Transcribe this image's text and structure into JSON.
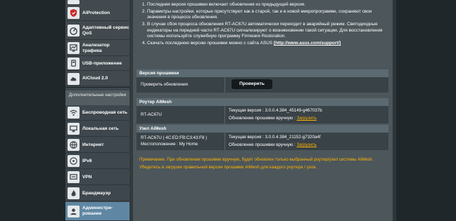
{
  "sidebar": {
    "items_top": [
      {
        "label": "",
        "icon": "folder-icon"
      },
      {
        "label": "AiProtection",
        "icon": "shield-icon"
      },
      {
        "label": "Адаптивный сервис QoS",
        "icon": "qos-icon"
      },
      {
        "label": "Анализатор трафика",
        "icon": "traffic-analyzer-icon"
      },
      {
        "label": "USB-приложение",
        "icon": "usb-icon"
      },
      {
        "label": "AiCloud 2.0",
        "icon": "cloud-icon"
      }
    ],
    "advanced_header": "Дополнительные настройки",
    "items_advanced": [
      {
        "label": "Беспроводная сеть",
        "icon": "wireless-icon"
      },
      {
        "label": "Локальная сеть",
        "icon": "lan-icon"
      },
      {
        "label": "Интернет",
        "icon": "globe-icon"
      },
      {
        "label": "IPv6",
        "icon": "ipv6-icon"
      },
      {
        "label": "VPN",
        "icon": "vpn-icon"
      },
      {
        "label": "Брандмауэр",
        "icon": "firewall-icon"
      },
      {
        "label": "Администри-рование",
        "icon": "admin-icon"
      }
    ]
  },
  "notes": {
    "items": [
      "Последняя версия прошивки включает обновления из предыдущей версии.",
      "Параметры настройки, которые присутствуют как в старой, так и в новой микропрограмме, сохраняют свои значения в процессе обновления.",
      "В случае сбоя процесса обновления RT-AC67U автоматически переходит в аварийный режим. Светодиодные индикаторы на передней части RT-AC67U сигнализируют о возникновении такой ситуации. Для восстановления системы используйте служебную программу Firmware Restoration."
    ],
    "last_prefix": "Скачать последнюю версию прошивки можно с сайта ASUS ",
    "last_link": "[http://www.asus.com/support/]"
  },
  "firmware": {
    "title": "Версия прошивки",
    "check_label": "Проверить обновления",
    "check_button": "Проверить"
  },
  "router": {
    "title": "Роутер AiMesh",
    "model": "RT-AC67U",
    "current_version": "Текущая версия : 3.0.0.4.384_45149-g467037b",
    "manual_update_label": "Обновление прошивки вручную :",
    "upload_link": "Загрузить"
  },
  "node": {
    "title": "Узел AiMesh",
    "model": "RT-AC67U ( 4C:ED:FB:C3:43:F8 )",
    "location": "Местоположение : My Home",
    "current_version": "Текущая версия : 3.0.0.4.384_21152-g7320a4f",
    "manual_update_label": "Обновление прошивки вручную :",
    "upload_link": "Загрузить"
  },
  "footnote": {
    "line1": "Примечание. При обновлении прошивки вручную, будет обновлен только выбранный роутер/узел системы AiMesh.",
    "line2": "Убедитесь в загрузке правильной версии прошивки AiMesh для каждого роутера / узла."
  },
  "colors": {
    "accent_yellow": "#ffb400",
    "active_item": "#5f87a3"
  }
}
